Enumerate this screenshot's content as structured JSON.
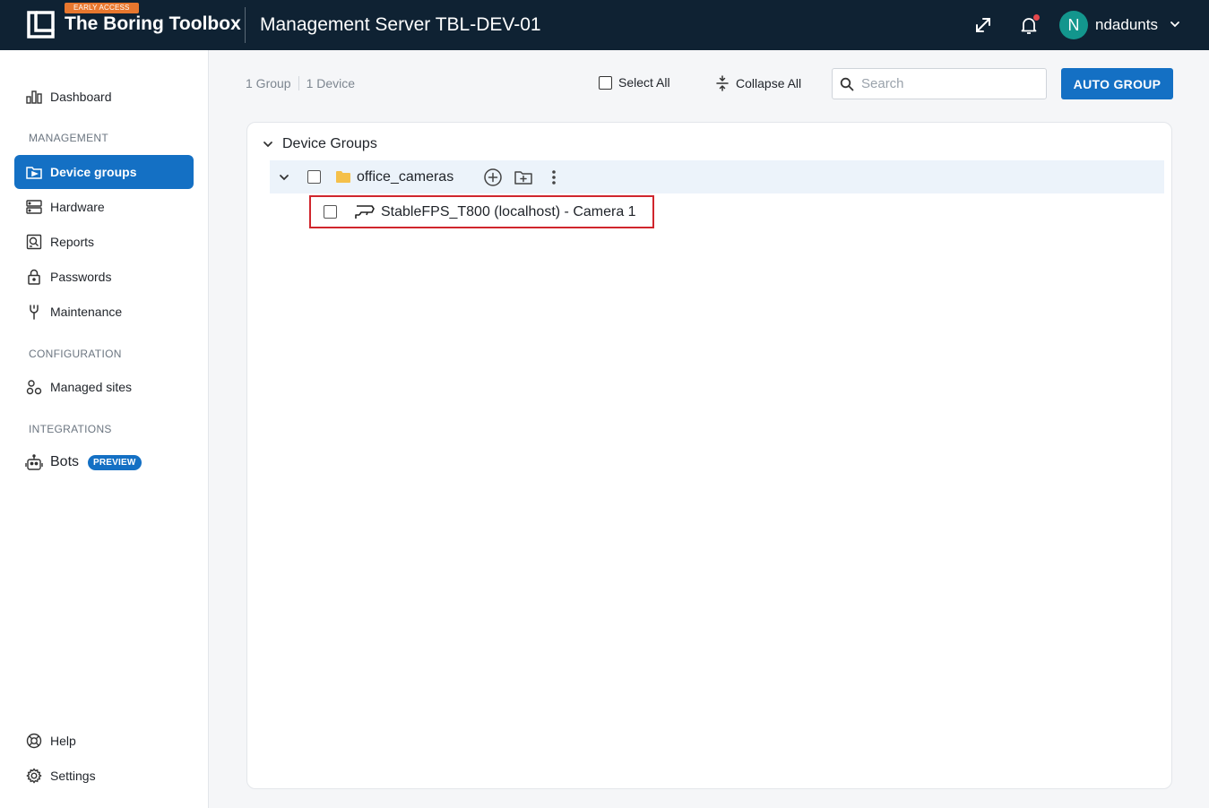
{
  "header": {
    "badge": "EARLY ACCESS",
    "brand": "The Boring Toolbox",
    "server_title": "Management Server TBL-DEV-01",
    "user": {
      "initial": "N",
      "name": "ndadunts"
    },
    "colors": {
      "bar": "#0f2233",
      "badge": "#e8772e",
      "avatar": "#13968d",
      "notification": "#e5484d"
    }
  },
  "sidebar": {
    "dashboard": "Dashboard",
    "sections": {
      "management": "MANAGEMENT",
      "configuration": "CONFIGURATION",
      "integrations": "INTEGRATIONS"
    },
    "management_items": [
      {
        "label": "Device groups",
        "icon": "device-groups-icon",
        "active": true
      },
      {
        "label": "Hardware",
        "icon": "server-icon"
      },
      {
        "label": "Reports",
        "icon": "report-icon"
      },
      {
        "label": "Passwords",
        "icon": "lock-icon"
      },
      {
        "label": "Maintenance",
        "icon": "wrench-icon"
      }
    ],
    "configuration_items": [
      {
        "label": "Managed sites",
        "icon": "sites-icon"
      }
    ],
    "integration_items": [
      {
        "label": "Bots",
        "icon": "robot-icon",
        "badge": "PREVIEW"
      }
    ],
    "footer_items": [
      {
        "label": "Help",
        "icon": "lifebuoy-icon"
      },
      {
        "label": "Settings",
        "icon": "gear-icon"
      }
    ],
    "accent": "#1470c4"
  },
  "toolbar": {
    "group_count": "1 Group",
    "device_count": "1 Device",
    "select_all": "Select All",
    "collapse_all": "Collapse All",
    "search_placeholder": "Search",
    "search_value": "",
    "auto_group": "AUTO GROUP"
  },
  "tree": {
    "root_label": "Device Groups",
    "groups": [
      {
        "name": "office_cameras",
        "expanded": true,
        "devices": [
          {
            "label": "StableFPS_T800 (localhost) - Camera 1",
            "icon": "camera-icon",
            "highlighted": true
          }
        ]
      }
    ],
    "colors": {
      "group_row": "#ecf3fa",
      "folder": "#f5c04a",
      "highlight": "#d0262d"
    }
  }
}
